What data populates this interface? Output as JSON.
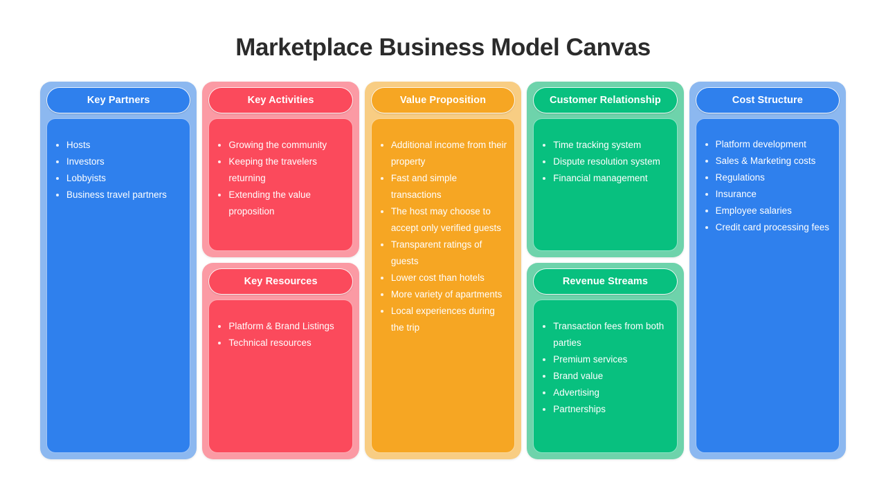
{
  "title": "Marketplace Business Model Canvas",
  "theme_colors": {
    "blue_fill": "#2f80ed",
    "blue_shell": "#8cb8f0",
    "red_fill": "#fb4a5c",
    "red_shell": "#fb9aa4",
    "orange_fill": "#f6a623",
    "orange_shell": "#f8cd83",
    "green_fill": "#08c07f",
    "green_shell": "#6ed3ab",
    "title_color": "#2b2b2b",
    "text_color": "#ffffff",
    "page_background": "#ffffff"
  },
  "columns": [
    {
      "id": "key-partners",
      "color": "blue",
      "blocks": [
        {
          "id": "key-partners",
          "header": "Key Partners",
          "items": [
            "Hosts",
            "Investors",
            "Lobbyists",
            "Business travel partners"
          ]
        }
      ]
    },
    {
      "id": "key-activities-resources",
      "color": "red",
      "blocks": [
        {
          "id": "key-activities",
          "header": "Key Activities",
          "items": [
            "Growing the community",
            "Keeping the travelers returning",
            "Extending the value proposition"
          ]
        },
        {
          "id": "key-resources",
          "header": "Key Resources",
          "items": [
            "Platform & Brand Listings",
            "Technical resources"
          ]
        }
      ]
    },
    {
      "id": "value-proposition",
      "color": "orange",
      "blocks": [
        {
          "id": "value-proposition",
          "header": "Value Proposition",
          "items": [
            "Additional income from their property",
            "Fast and simple transactions",
            "The host may choose to accept only verified guests",
            "Transparent ratings of guests",
            "Lower cost than hotels",
            "More variety of apartments",
            "Local experiences during the trip"
          ]
        }
      ]
    },
    {
      "id": "customer-revenue",
      "color": "green",
      "blocks": [
        {
          "id": "customer-relationship",
          "header": "Customer Relationship",
          "items": [
            "Time tracking system",
            "Dispute resolution system",
            "Financial management"
          ]
        },
        {
          "id": "revenue-streams",
          "header": "Revenue Streams",
          "items": [
            "Transaction fees from both parties",
            "Premium services",
            "Brand value",
            "Advertising",
            "Partnerships"
          ]
        }
      ]
    },
    {
      "id": "cost-structure",
      "color": "blue",
      "blocks": [
        {
          "id": "cost-structure",
          "header": "Cost Structure",
          "items": [
            "Platform development",
            "Sales & Marketing costs",
            "Regulations",
            "Insurance",
            "Employee salaries",
            "Credit card processing fees"
          ]
        }
      ]
    }
  ]
}
